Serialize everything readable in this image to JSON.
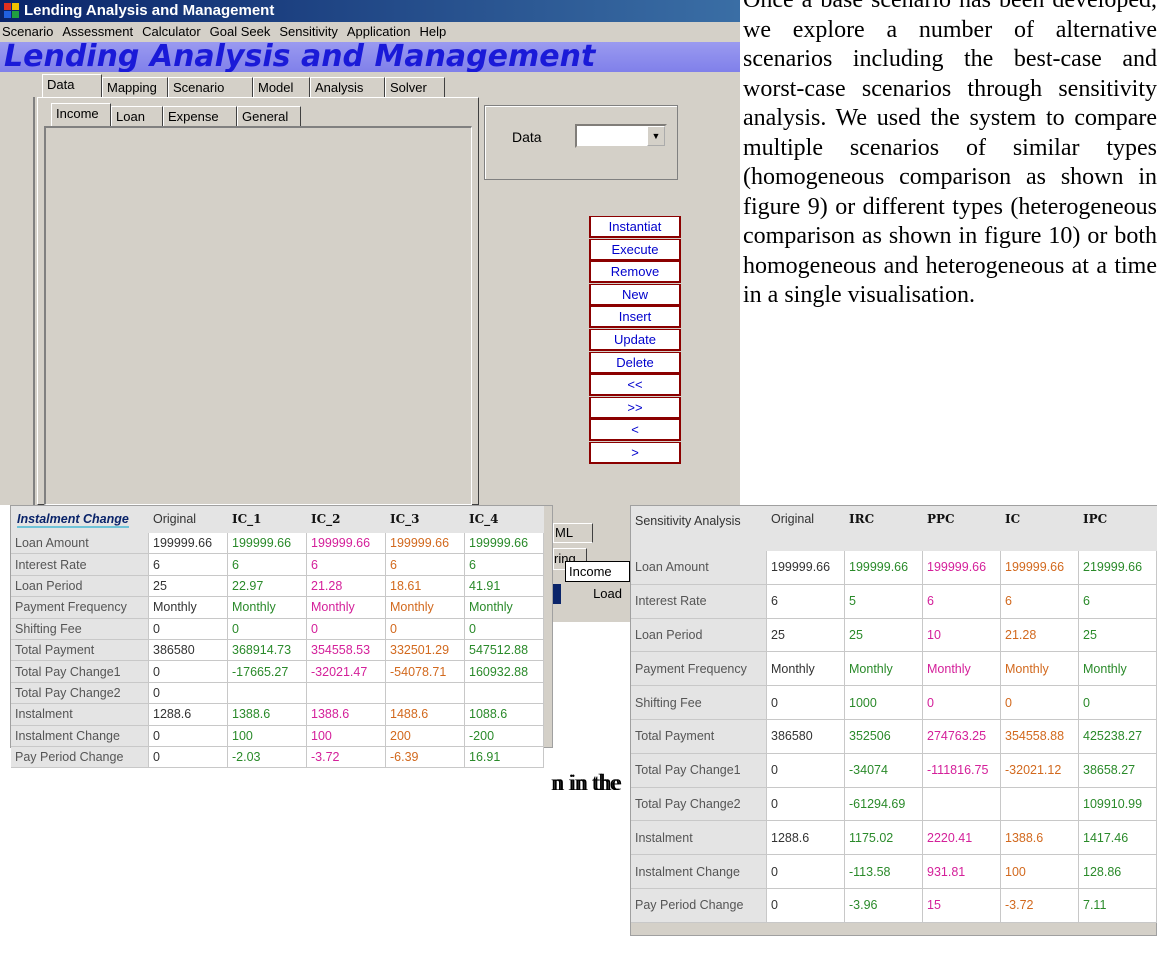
{
  "window": {
    "title": "Lending Analysis and Management",
    "menu": [
      "Scenario",
      "Assessment",
      "Calculator",
      "Goal Seek",
      "Sensitivity",
      "Application",
      "Help"
    ],
    "banner": "Lending Analysis and Management",
    "tabs_top": [
      "Data",
      "Mapping",
      "Scenario",
      "Model",
      "Analysis",
      "Solver"
    ],
    "tabs_data": [
      "Income",
      "Loan",
      "Expense",
      "General"
    ],
    "data_label": "Data",
    "buttons": [
      "Instantiat",
      "Execute",
      "Remove",
      "New",
      "Insert",
      "Update",
      "Delete",
      "<<",
      ">>",
      "<",
      ">"
    ],
    "partial": {
      "ml_tab": "ML",
      "ring_tab": "ring",
      "income_value": "Income",
      "load_button": "Load",
      "occluded_text": "n in the"
    }
  },
  "paragraph": "Once a base scenario has been developed, we explore a number of alternative scenarios including the best-case and worst-case scenarios through sensitivity analysis. We used the system to compare multiple scenarios of similar types (homogeneous comparison as shown in figure 9) or different types (heterogeneous comparison as shown in figure 10) or both homogeneous and heterogeneous at a time in a single visualisation.",
  "colors": {
    "original": "#333333",
    "green": "#2a8a2a",
    "magenta": "#d4209a",
    "orange": "#d2691e"
  },
  "instalment_table": {
    "corner": "Instalment Change",
    "columns": [
      "Original",
      "IC_1",
      "IC_2",
      "IC_3",
      "IC_4"
    ],
    "column_colors": [
      "original",
      "green",
      "magenta",
      "orange",
      "green"
    ],
    "rows": [
      {
        "label": "Loan Amount",
        "values": [
          "199999.66",
          "199999.66",
          "199999.66",
          "199999.66",
          "199999.66"
        ]
      },
      {
        "label": "Interest Rate",
        "values": [
          "6",
          "6",
          "6",
          "6",
          "6"
        ]
      },
      {
        "label": "Loan Period",
        "values": [
          "25",
          "22.97",
          "21.28",
          "18.61",
          "41.91"
        ]
      },
      {
        "label": "Payment Frequency",
        "values": [
          "Monthly",
          "Monthly",
          "Monthly",
          "Monthly",
          "Monthly"
        ]
      },
      {
        "label": "Shifting Fee",
        "values": [
          "0",
          "0",
          "0",
          "0",
          "0"
        ]
      },
      {
        "label": "Total Payment",
        "values": [
          "386580",
          "368914.73",
          "354558.53",
          "332501.29",
          "547512.88"
        ]
      },
      {
        "label": "Total Pay Change1",
        "values": [
          "0",
          "-17665.27",
          "-32021.47",
          "-54078.71",
          "160932.88"
        ]
      },
      {
        "label": "Total Pay Change2",
        "values": [
          "0",
          "",
          "",
          "",
          ""
        ]
      },
      {
        "label": "Instalment",
        "values": [
          "1288.6",
          "1388.6",
          "1388.6",
          "1488.6",
          "1088.6"
        ]
      },
      {
        "label": "Instalment Change",
        "values": [
          "0",
          "100",
          "100",
          "200",
          "-200"
        ]
      },
      {
        "label": "Pay Period Change",
        "values": [
          "0",
          "-2.03",
          "-3.72",
          "-6.39",
          "16.91"
        ]
      }
    ]
  },
  "sensitivity_table": {
    "corner": "Sensitivity Analysis",
    "columns": [
      "Original",
      "IRC",
      "PPC",
      "IC",
      "IPC"
    ],
    "column_colors": [
      "original",
      "green",
      "magenta",
      "orange",
      "green"
    ],
    "rows": [
      {
        "label": "Loan Amount",
        "values": [
          "199999.66",
          "199999.66",
          "199999.66",
          "199999.66",
          "219999.66"
        ]
      },
      {
        "label": "Interest Rate",
        "values": [
          "6",
          "5",
          "6",
          "6",
          "6"
        ]
      },
      {
        "label": "Loan Period",
        "values": [
          "25",
          "25",
          "10",
          "21.28",
          "25"
        ]
      },
      {
        "label": "Payment Frequency",
        "values": [
          "Monthly",
          "Monthly",
          "Monthly",
          "Monthly",
          "Monthly"
        ]
      },
      {
        "label": "Shifting Fee",
        "values": [
          "0",
          "1000",
          "0",
          "0",
          "0"
        ]
      },
      {
        "label": "Total Payment",
        "values": [
          "386580",
          "352506",
          "274763.25",
          "354558.88",
          "425238.27"
        ]
      },
      {
        "label": "Total Pay Change1",
        "values": [
          "0",
          "-34074",
          "-111816.75",
          "-32021.12",
          "38658.27"
        ]
      },
      {
        "label": "Total Pay Change2",
        "values": [
          "0",
          "-61294.69",
          "",
          "",
          "109910.99"
        ]
      },
      {
        "label": "Instalment",
        "values": [
          "1288.6",
          "1175.02",
          "2220.41",
          "1388.6",
          "1417.46"
        ]
      },
      {
        "label": "Instalment Change",
        "values": [
          "0",
          "-113.58",
          "931.81",
          "100",
          "128.86"
        ]
      },
      {
        "label": "Pay Period Change",
        "values": [
          "0",
          "-3.96",
          "15",
          "-3.72",
          "7.11"
        ]
      }
    ]
  }
}
